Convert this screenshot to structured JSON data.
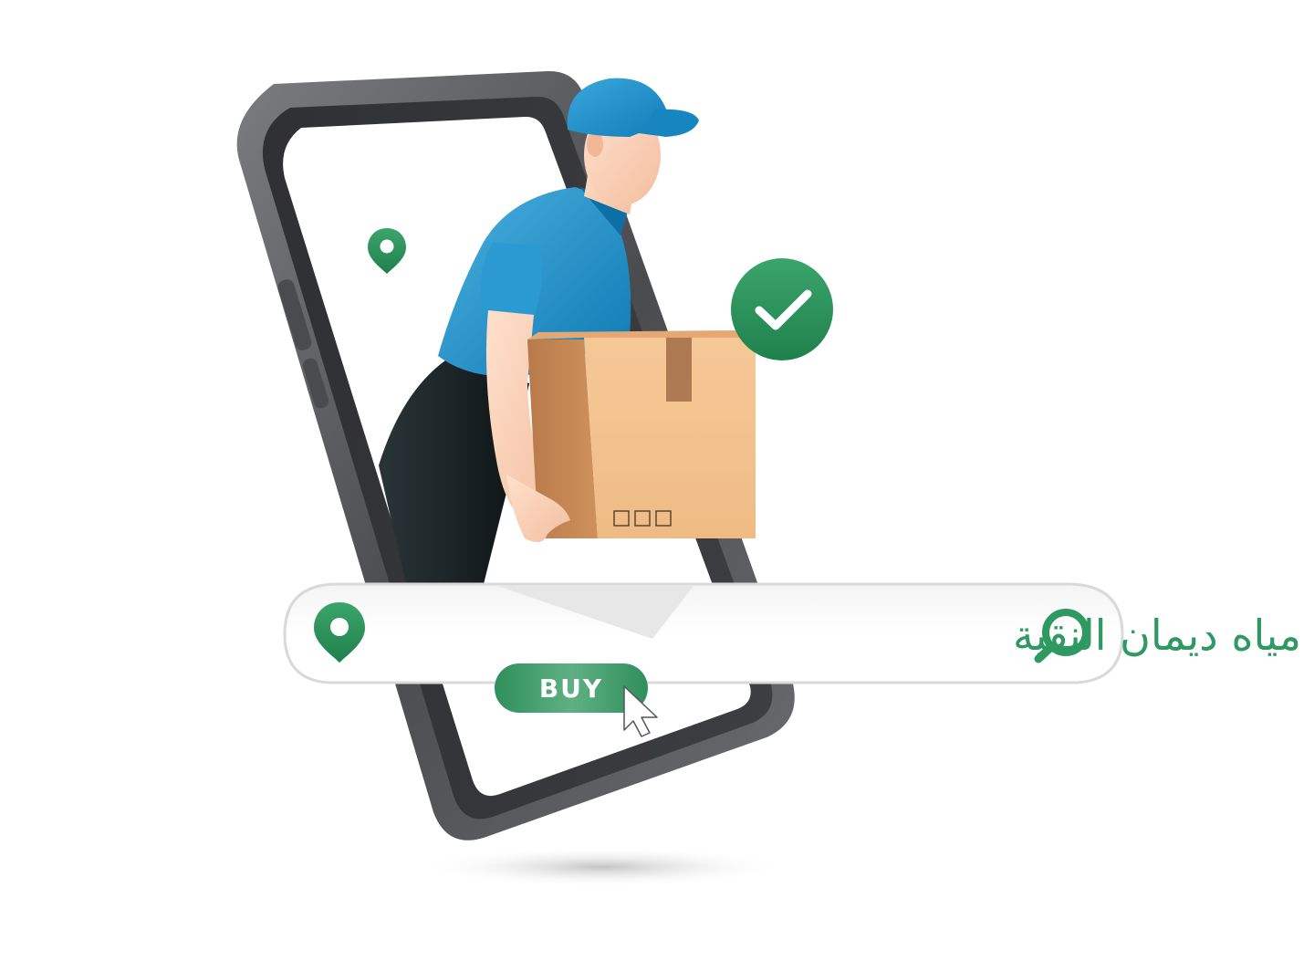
{
  "search": {
    "query": "مياه ديمان النقية"
  },
  "buy_button": {
    "label": "BUY"
  },
  "colors": {
    "brand_green": "#2e9a62",
    "brand_green_dark": "#1f7a4a",
    "phone_frame": "#5a5b5e",
    "uniform_blue": "#1a8fc9",
    "box_cardboard": "#f1c08f"
  },
  "icons": {
    "map_pin": "map-pin-icon",
    "check": "check-icon",
    "search": "search-icon",
    "cursor": "cursor-icon"
  }
}
